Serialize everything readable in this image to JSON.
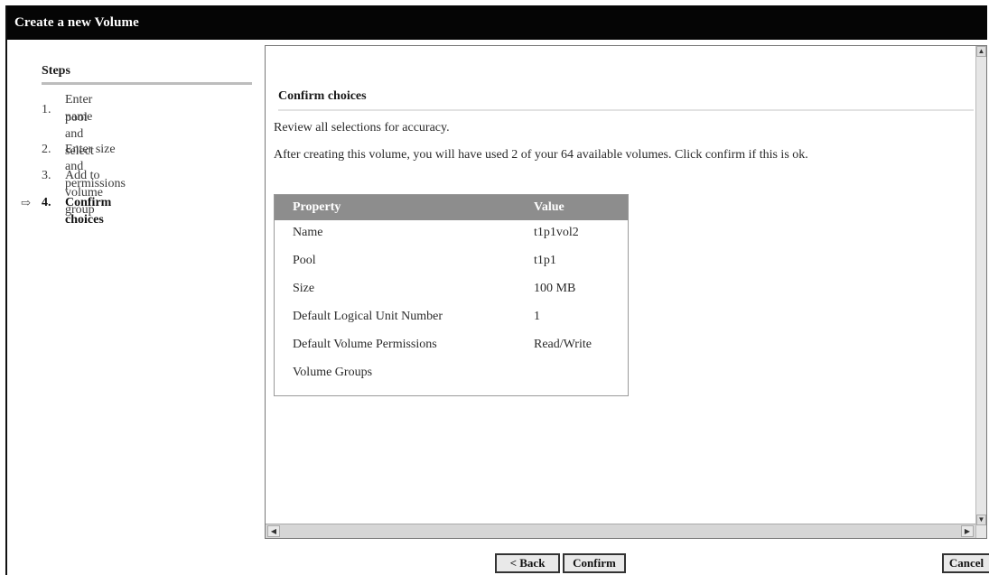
{
  "window": {
    "title": "Create a new Volume"
  },
  "steps": {
    "title": "Steps",
    "items": [
      {
        "number": "1.",
        "label_line1": "Enter name and select",
        "label_line2": "pool"
      },
      {
        "number": "2.",
        "label": "Enter size and permissions"
      },
      {
        "number": "3.",
        "label": "Add to volume group"
      },
      {
        "number": "4.",
        "label": "Confirm choices",
        "active": true
      }
    ],
    "current_indicator": "⇨"
  },
  "content": {
    "title": "Confirm choices",
    "intro": "Review all selections for accuracy.",
    "notice": "After creating this volume, you will have used 2 of your 64 available volumes. Click confirm if this is ok.",
    "table": {
      "headers": [
        "Property",
        "Value"
      ],
      "rows": [
        [
          "Name",
          "t1p1vol2"
        ],
        [
          "Pool",
          "t1p1"
        ],
        [
          "Size",
          "100 MB"
        ],
        [
          "Default Logical Unit Number",
          "1"
        ],
        [
          "Default Volume Permissions",
          "Read/Write"
        ],
        [
          "Volume Groups",
          ""
        ]
      ]
    }
  },
  "footer": {
    "back_label": "Back",
    "back_glyph": "<",
    "confirm_label": "Confirm",
    "cancel_label": "Cancel"
  },
  "colors": {
    "titlebar": "#050505",
    "table_header": "#8d8d8d",
    "button_face": "#e9e9e9"
  }
}
